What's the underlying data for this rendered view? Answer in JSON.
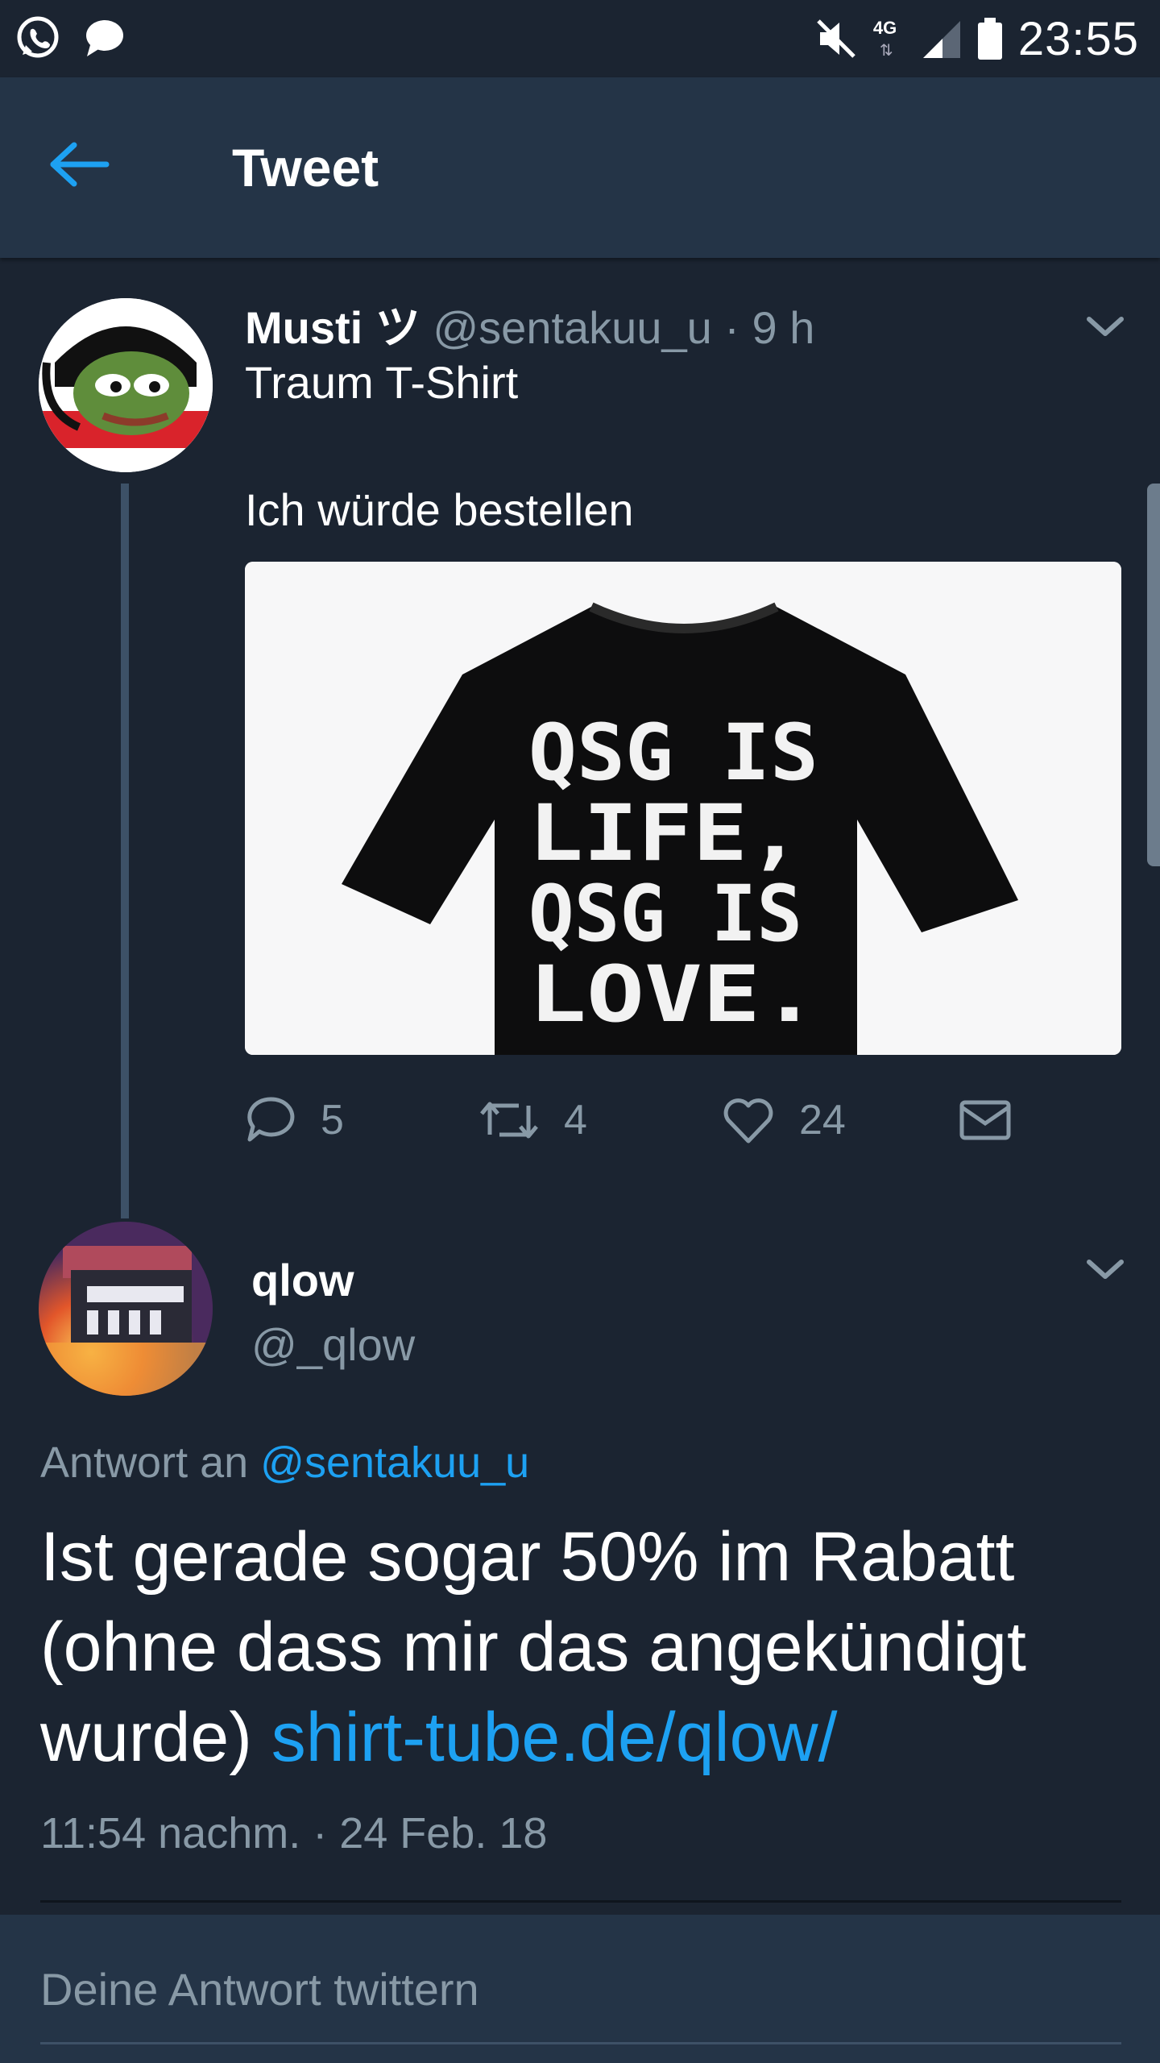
{
  "status_bar": {
    "time": "23:55",
    "network": "4G",
    "left_icons": [
      "whatsapp-icon",
      "chat-bubble-icon"
    ],
    "right_icons": [
      "mute-icon",
      "network-4g-icon",
      "signal-icon",
      "battery-icon"
    ]
  },
  "app_bar": {
    "title": "Tweet",
    "back_icon": "arrow-left-icon"
  },
  "colors": {
    "background": "#1b2431",
    "bar": "#243447",
    "accent": "#1da1f2",
    "muted": "#8899a6"
  },
  "parent_tweet": {
    "name": "Musti ツ",
    "handle_time": "@sentakuu_u · 9 h",
    "text_line1": "Traum T-Shirt",
    "text_line2": "Ich würde bestellen",
    "image_text": {
      "line1": "QSG IS",
      "line2": "LIFE,",
      "line3": "QSG IS",
      "line4": "LOVE."
    },
    "actions": {
      "replies": "5",
      "retweets": "4",
      "likes": "24"
    }
  },
  "main_tweet": {
    "name": "qlow",
    "handle": "@_qlow",
    "reply_prefix": "Antwort an ",
    "reply_mention": "@sentakuu_u",
    "text": "Ist gerade sogar 50% im Rabatt (ohne dass mir das angekündigt wurde) ",
    "link": "shirt-tube.de/qlow/",
    "timestamp": "11:54 nachm. · 24 Feb. 18"
  },
  "reply_bar": {
    "placeholder": "Deine Antwort twittern"
  }
}
